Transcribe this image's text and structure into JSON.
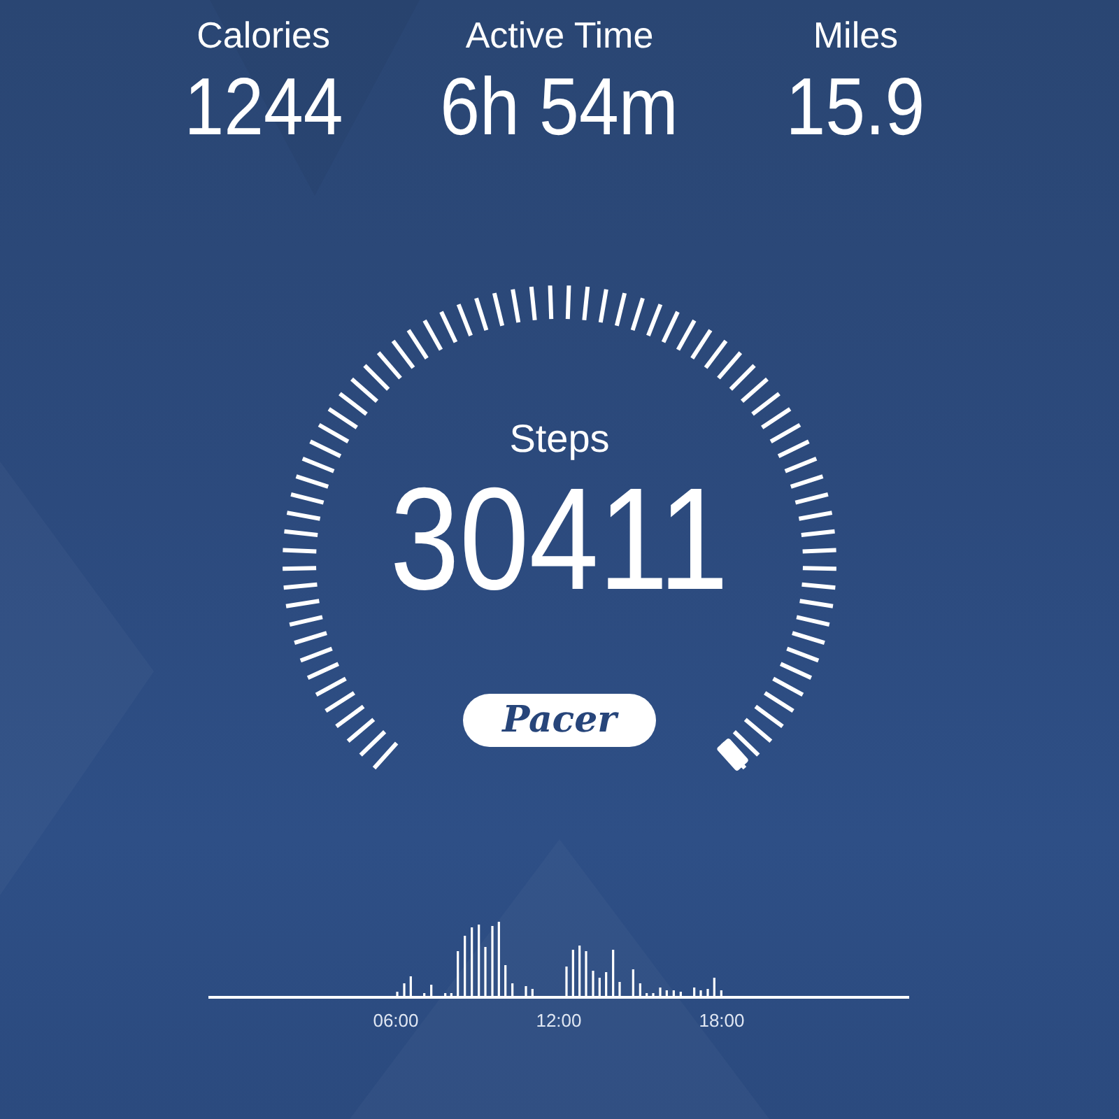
{
  "stats": [
    {
      "label": "Calories",
      "value": "1244"
    },
    {
      "label": "Active Time",
      "value": "6h 54m"
    },
    {
      "label": "Miles",
      "value": "15.9"
    }
  ],
  "gauge": {
    "label": "Steps",
    "value": "30411"
  },
  "badge": "Pacer",
  "activity_chart": {
    "ticks": [
      "06:00",
      "12:00",
      "18:00"
    ]
  }
}
